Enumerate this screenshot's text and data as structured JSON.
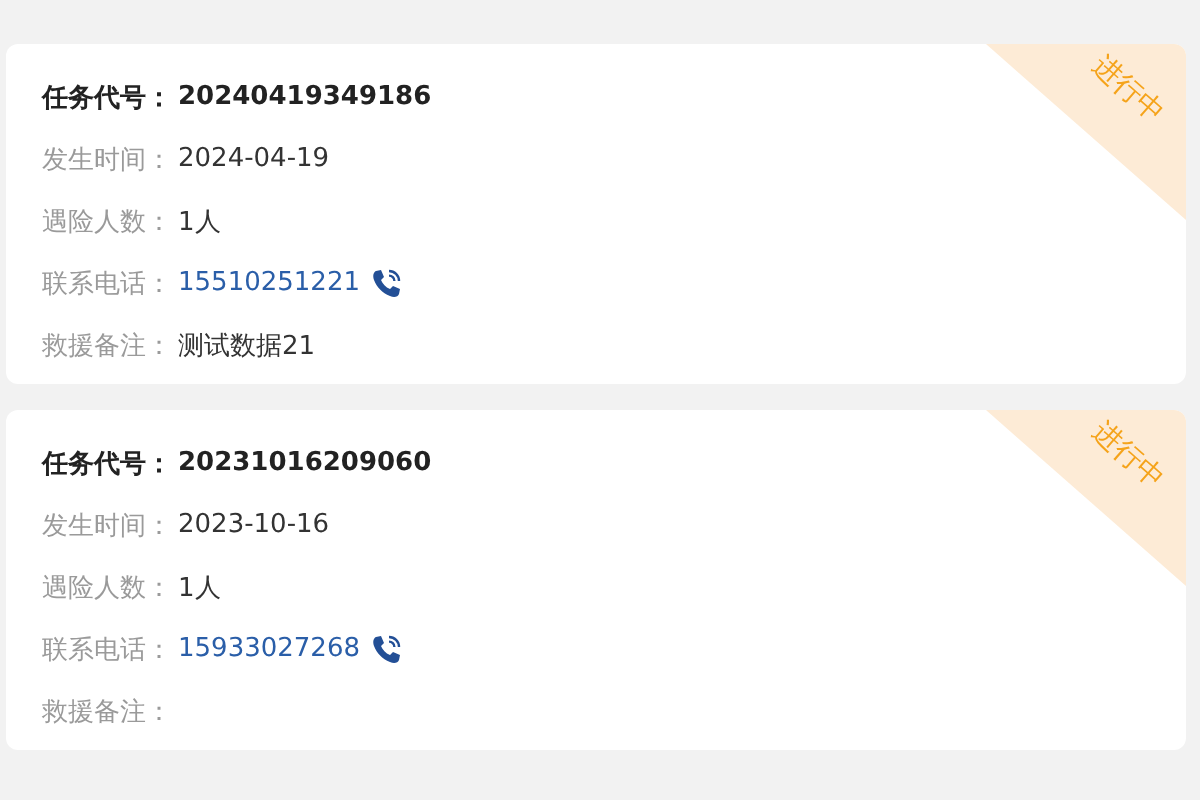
{
  "tasks": [
    {
      "status": "进行中",
      "rows": [
        {
          "kind": "code",
          "label": "任务代号：",
          "value": "20240419349186"
        },
        {
          "kind": "text",
          "label": "发生时间：",
          "value": "2024-04-19"
        },
        {
          "kind": "text",
          "label": "遇险人数：",
          "value": "1人"
        },
        {
          "kind": "phone",
          "label": "联系电话：",
          "value": "15510251221"
        },
        {
          "kind": "text",
          "label": "救援备注：",
          "value": "测试数据21"
        }
      ]
    },
    {
      "status": "进行中",
      "rows": [
        {
          "kind": "code",
          "label": "任务代号：",
          "value": "20231016209060"
        },
        {
          "kind": "text",
          "label": "发生时间：",
          "value": "2023-10-16"
        },
        {
          "kind": "text",
          "label": "遇险人数：",
          "value": "1人"
        },
        {
          "kind": "phone",
          "label": "联系电话：",
          "value": "15933027268"
        },
        {
          "kind": "text",
          "label": "救援备注："
        }
      ]
    }
  ]
}
